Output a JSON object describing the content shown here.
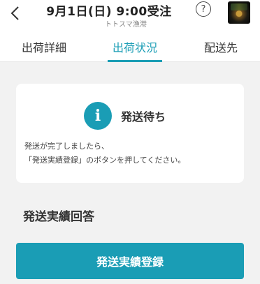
{
  "header": {
    "title": "9月1日(日) 9:00受注",
    "subtitle": "トトスマ漁港",
    "help_icon": "?"
  },
  "tabs": [
    {
      "label": "出荷詳細",
      "active": false
    },
    {
      "label": "出荷状況",
      "active": true
    },
    {
      "label": "配送先",
      "active": false
    }
  ],
  "status_card": {
    "icon": "i",
    "title": "発送待ち",
    "message_line1": "発送が完了しましたら、",
    "message_line2": "「発送実績登録」のボタンを押してください。"
  },
  "section": {
    "heading": "発送実績回答"
  },
  "submit_button": {
    "label": "発送実績登録"
  },
  "colors": {
    "accent": "#1a9db5",
    "background": "#f2f2f2"
  }
}
